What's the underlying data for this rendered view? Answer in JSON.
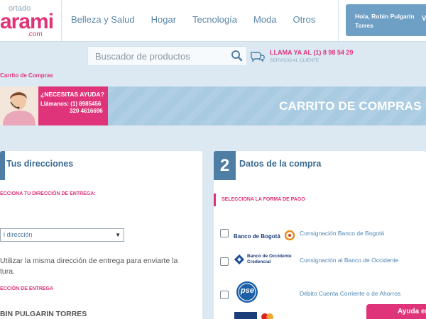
{
  "logo": {
    "top": "ortado",
    "main": "arami",
    "sub": ".com"
  },
  "nav": [
    "Belleza y Salud",
    "Hogar",
    "Tecnología",
    "Moda",
    "Otros"
  ],
  "user": {
    "greeting_line1": "Hola, Robin Pulgarin",
    "greeting_line2": "Torres",
    "chevron": "∨"
  },
  "search": {
    "placeholder": "Buscador de productos"
  },
  "hotline": {
    "label": "LLAMA YA AL (1) 8 98 54 29",
    "sub": "SERVICIO AL CLIENTE"
  },
  "breadcrumb": "Carrito de Compras",
  "banner": {
    "help_title": "¿NECESITAS AYUDA?",
    "help_line1": "Llámanos: (1) 8985456",
    "help_line2": "320 4616696",
    "title": "CARRITO DE COMPRAS"
  },
  "left_panel": {
    "title": "Tus direcciones",
    "select_label": "ECCIONA TU DIRECCIÓN DE ENTREGA:",
    "select_value": "i dirección",
    "same_address_line1": "Utilizar la misma dirección de entrega para enviarte la",
    "same_address_line2": "tura.",
    "delivery_label": "ECCIÓN DE ENTREGA",
    "name": "BIN PULGARIN TORRES"
  },
  "right_panel": {
    "step": "2",
    "title": "Datos de la compra",
    "payment_label": "SELECCIONA LA FORMA DE PAGO",
    "methods": [
      {
        "bank": "Banco de Bogotá",
        "label": "Consignación Banco de Bogotá"
      },
      {
        "bank_line1": "Banco de Occidente",
        "bank_line2": "Credencial",
        "label": "Consignación al Banco de Occidente"
      },
      {
        "bank": "pse",
        "label": "Débito Cuenta Corriente o de Ahorros"
      }
    ]
  },
  "ayuda": "Ayuda en",
  "colors": {
    "accent_pink": "#e0347a",
    "primary_blue": "#4f7ea5",
    "background": "#dce9f3"
  }
}
